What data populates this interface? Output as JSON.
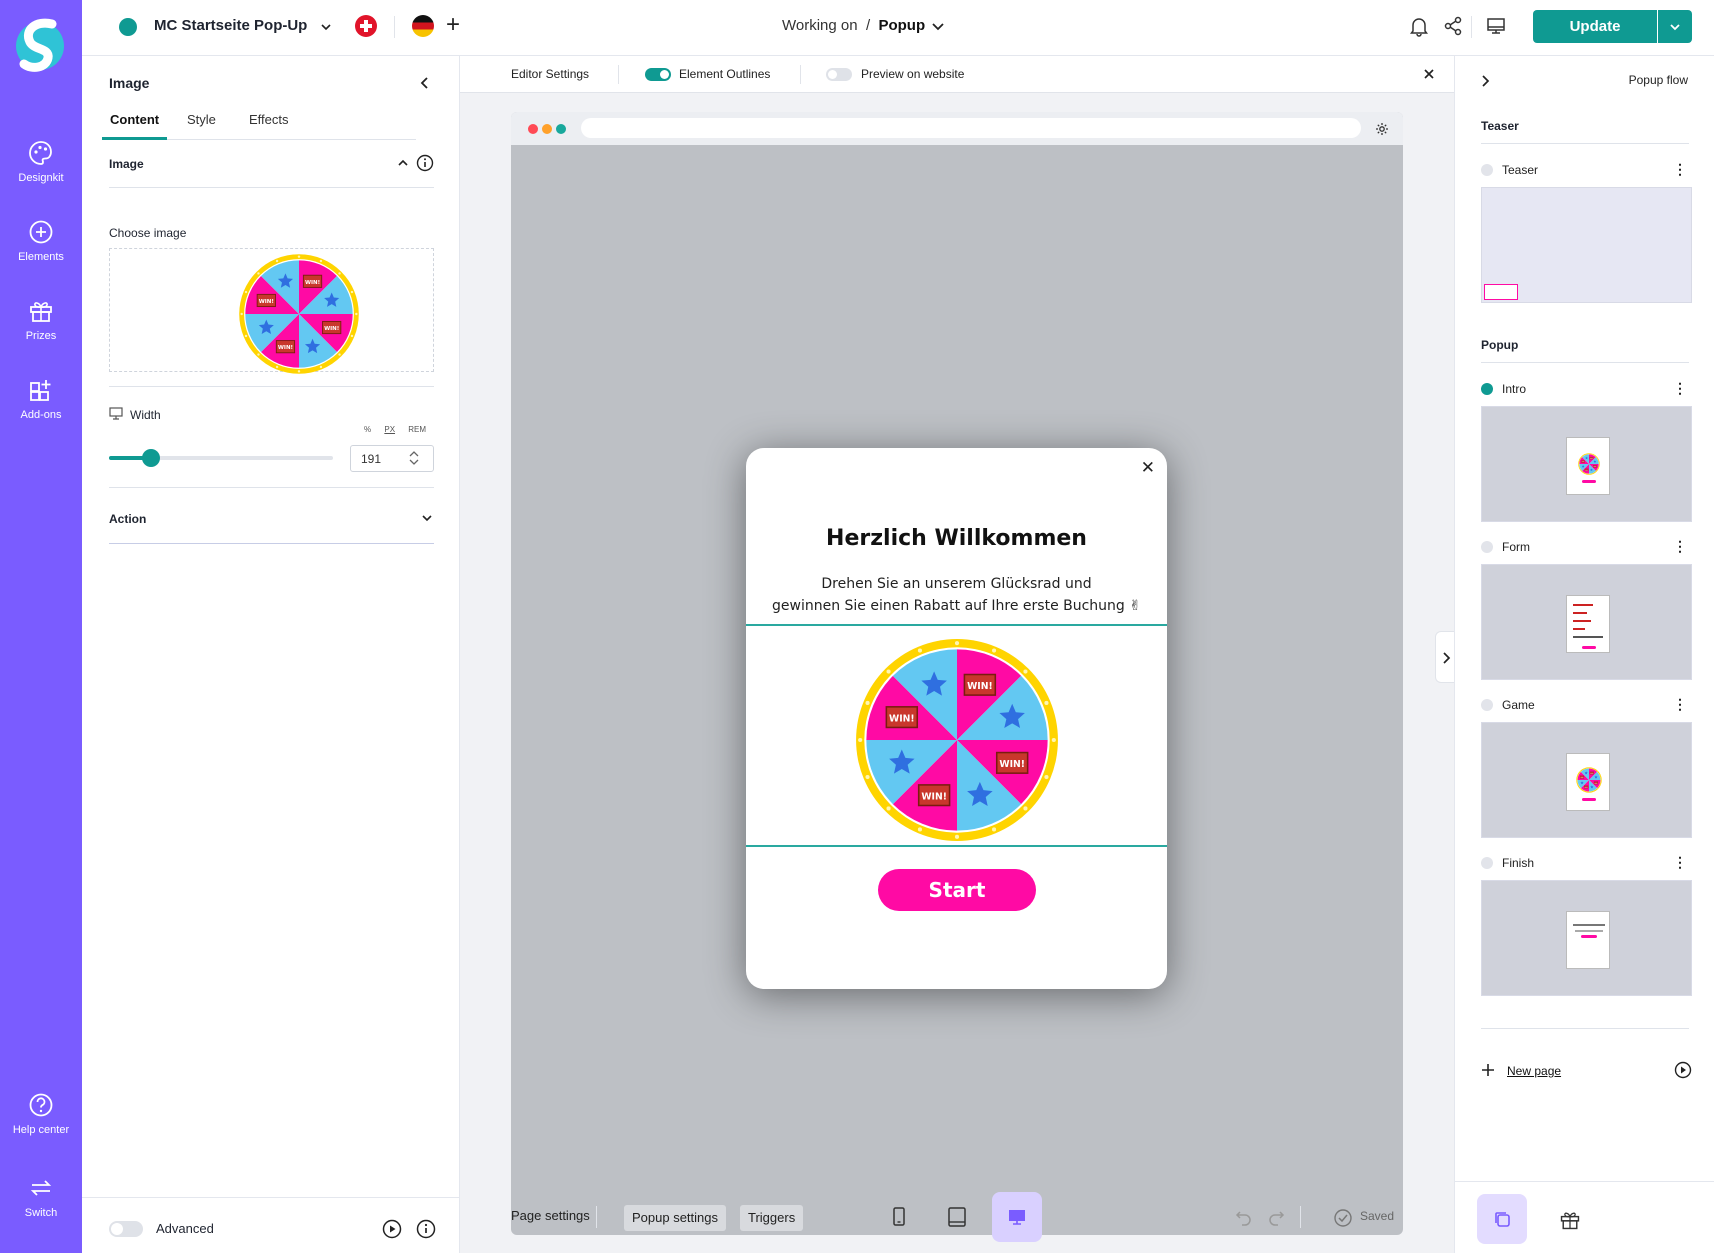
{
  "colors": {
    "rail": "#7a5cff",
    "accent": "#0f9a92",
    "popup_button": "#ff0aa4",
    "wheel_pink": "#ff0aa4",
    "wheel_blue": "#63c8f2",
    "wheel_rim": "#ffd400"
  },
  "rail": {
    "items": [
      {
        "label": "Designkit",
        "icon": "palette-icon"
      },
      {
        "label": "Elements",
        "icon": "plus-circle-icon"
      },
      {
        "label": "Prizes",
        "icon": "gift-icon"
      },
      {
        "label": "Add-ons",
        "icon": "addon-grid-icon"
      }
    ],
    "bottom": [
      {
        "label": "Help center",
        "icon": "help-icon"
      },
      {
        "label": "Switch",
        "icon": "switch-icon"
      }
    ]
  },
  "topbar": {
    "project_name": "MC Startseite Pop-Up",
    "working_on": "Working on",
    "separator": "/",
    "current": "Popup",
    "update_label": "Update"
  },
  "left_panel": {
    "title": "Image",
    "tabs": [
      "Content",
      "Style",
      "Effects"
    ],
    "active_tab": "Content",
    "section_image": "Image",
    "choose_image": "Choose image",
    "width_label": "Width",
    "units": [
      "%",
      "PX",
      "REM"
    ],
    "active_unit": "PX",
    "width_value": "191",
    "slider_fraction": 0.18,
    "section_action": "Action",
    "advanced_label": "Advanced"
  },
  "editor_bar": {
    "editor_settings": "Editor Settings",
    "element_outlines": "Element Outlines",
    "element_outlines_on": true,
    "preview": "Preview on website",
    "preview_on": false
  },
  "popup": {
    "title": "Herzlich Willkommen",
    "description_line1": "Drehen Sie an unserem Glücksrad und",
    "description_line2": "gewinnen Sie einen Rabatt auf Ihre erste Buchung ✌",
    "button": "Start",
    "wheel_label": "WIN!"
  },
  "bottom_bar": {
    "page_settings": "Page settings",
    "popup_settings": "Popup settings",
    "triggers": "Triggers",
    "saved": "Saved"
  },
  "right_panel": {
    "flow_title": "Popup flow",
    "group_teaser": "Teaser",
    "group_popup": "Popup",
    "pages": [
      {
        "name": "Teaser",
        "active": false
      },
      {
        "name": "Intro",
        "active": true
      },
      {
        "name": "Form",
        "active": false
      },
      {
        "name": "Game",
        "active": false
      },
      {
        "name": "Finish",
        "active": false
      }
    ],
    "new_page": "New page"
  }
}
